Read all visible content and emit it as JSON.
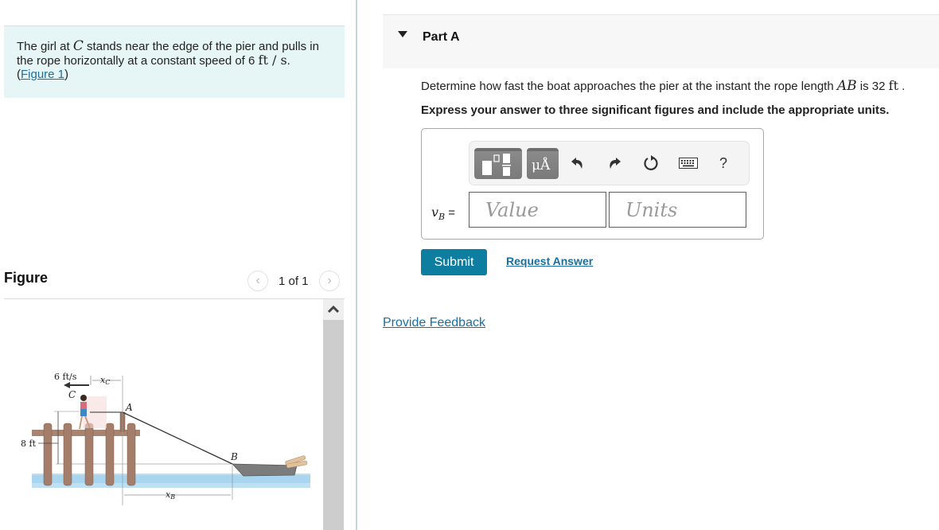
{
  "problem": {
    "text_1": "The girl at ",
    "var_c": "C",
    "text_2": " stands near the edge of the pier and pulls in the rope horizontally at a constant speed of 6 ",
    "unit_ft": "ft",
    "unit_sep": " / ",
    "unit_s": "s",
    "text_3": ".",
    "figure_link_open": "(",
    "figure_link": "Figure 1",
    "figure_link_close": ")"
  },
  "figure": {
    "title": "Figure",
    "counter": "1 of 1",
    "prev_icon": "chevron-left-icon",
    "next_icon": "chevron-right-icon",
    "scroll_up_icon": "chevron-up-icon",
    "labels": {
      "speed": "6 ft/s",
      "xc": "x",
      "xc_sub": "C",
      "c": "C",
      "a": "A",
      "b": "B",
      "height": "8 ft",
      "xb": "x",
      "xb_sub": "B"
    }
  },
  "part": {
    "title": "Part A",
    "question_1": "Determine how fast the boat approaches the pier at the instant the rope length ",
    "question_var": "AB",
    "question_2": " is 32 ",
    "question_unit": "ft",
    "question_3": " .",
    "instruction": "Express your answer to three significant figures and include the appropriate units."
  },
  "toolbar": {
    "template_icon": "templates-icon",
    "units_label": "μÅ",
    "undo_icon": "undo-icon",
    "redo_icon": "redo-icon",
    "reset_icon": "reset-icon",
    "keyboard_icon": "keyboard-icon",
    "help_label": "?"
  },
  "answer": {
    "label_var": "v",
    "label_sub": "B",
    "label_eq": " =",
    "value": "",
    "value_placeholder": "Value",
    "units": "",
    "units_placeholder": "Units"
  },
  "actions": {
    "submit": "Submit",
    "request_answer": "Request Answer",
    "feedback": "Provide Feedback"
  },
  "colors": {
    "accent": "#0e7ea0",
    "link": "#1a6fa0",
    "problem_bg": "#e6f5f5"
  }
}
